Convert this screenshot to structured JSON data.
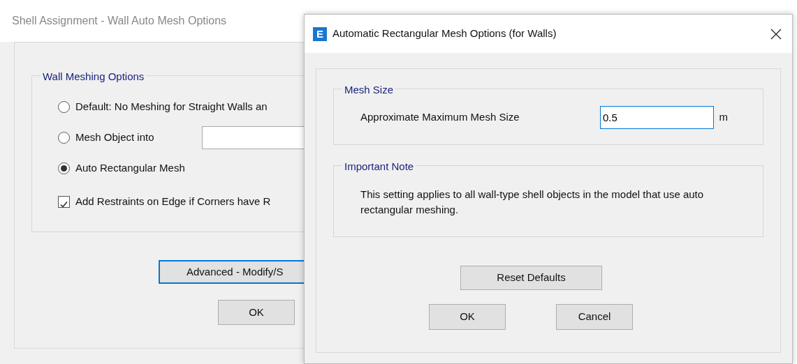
{
  "back_window": {
    "title": "Shell Assignment - Wall Auto Mesh Options",
    "group": {
      "title": "Wall Meshing Options",
      "options": [
        {
          "kind": "radio",
          "label": "Default:  No Meshing for Straight Walls an",
          "selected": false
        },
        {
          "kind": "radio_with_field",
          "label": "Mesh Object into",
          "selected": false
        },
        {
          "kind": "radio",
          "label": "Auto Rectangular Mesh",
          "selected": true
        },
        {
          "kind": "checkbox",
          "label": "Add Restraints on Edge if Corners have R",
          "checked": true
        }
      ]
    },
    "buttons": [
      {
        "label": "Advanced - Modify/S",
        "focused": true
      },
      {
        "label": "OK",
        "focused": false
      }
    ]
  },
  "dialog": {
    "app_icon_letter": "E",
    "title": "Automatic Rectangular Mesh Options (for Walls)",
    "mesh_size": {
      "title": "Mesh Size",
      "label": "Approximate Maximum Mesh Size",
      "value": "0.5",
      "unit": "m"
    },
    "note": {
      "title": "Important Note",
      "text": "This setting applies to all wall-type shell objects in the model that use auto rectangular meshing."
    },
    "buttons": [
      {
        "label": "Reset Defaults"
      },
      {
        "label": "OK"
      },
      {
        "label": "Cancel"
      }
    ]
  }
}
